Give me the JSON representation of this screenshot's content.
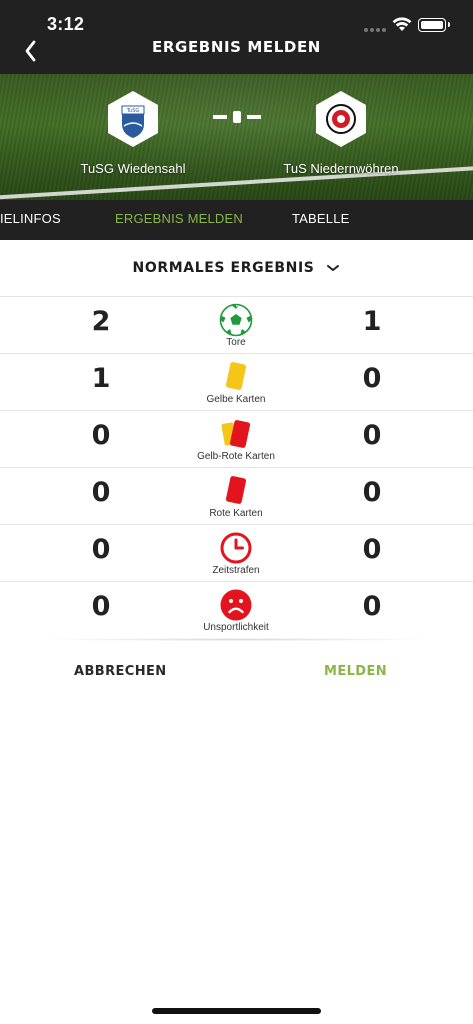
{
  "status_bar": {
    "time": "3:12"
  },
  "header": {
    "title": "ERGEBNIS MELDEN"
  },
  "match": {
    "home_team": "TuSG Wiedensahl",
    "away_team": "TuS Niedernwöhren"
  },
  "tabs": [
    {
      "label": "IELINFOS",
      "active": false
    },
    {
      "label": "ERGEBNIS MELDEN",
      "active": true
    },
    {
      "label": "TABELLE",
      "active": false
    }
  ],
  "result_type": {
    "selected": "NORMALES ERGEBNIS"
  },
  "stats": [
    {
      "label": "Tore",
      "icon": "soccer-ball-icon",
      "home": "2",
      "away": "1"
    },
    {
      "label": "Gelbe Karten",
      "icon": "yellow-card-icon",
      "home": "1",
      "away": "0"
    },
    {
      "label": "Gelb-Rote Karten",
      "icon": "yellow-red-card-icon",
      "home": "0",
      "away": "0"
    },
    {
      "label": "Rote Karten",
      "icon": "red-card-icon",
      "home": "0",
      "away": "0"
    },
    {
      "label": "Zeitstrafen",
      "icon": "clock-icon",
      "home": "0",
      "away": "0"
    },
    {
      "label": "Unsportlichkeit",
      "icon": "sad-face-icon",
      "home": "0",
      "away": "0"
    }
  ],
  "actions": {
    "cancel_label": "ABBRECHEN",
    "submit_label": "MELDEN"
  },
  "colors": {
    "accent": "#8ab548",
    "dark": "#212121",
    "red": "#e3141d",
    "yellow": "#f5c518",
    "green": "#1f9a3c"
  }
}
